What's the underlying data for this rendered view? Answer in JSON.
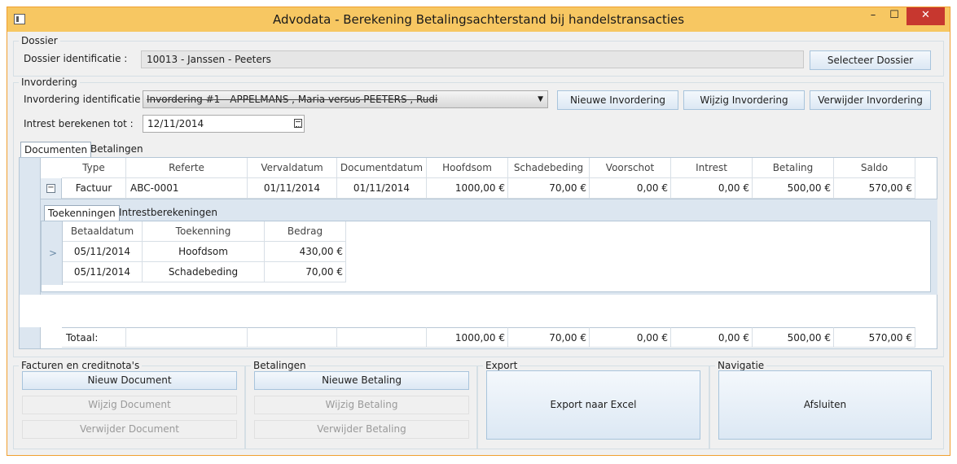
{
  "window": {
    "title": "Advodata - Berekening Betalingsachterstand bij handelstransacties",
    "minimize_icon": "minimize-icon",
    "maximize_icon": "maximize-icon",
    "close_icon": "close-icon",
    "minimize_glyph": "–",
    "maximize_glyph": "☐",
    "close_glyph": "✕"
  },
  "dossier": {
    "legend": "Dossier",
    "label": "Dossier identificatie :",
    "value": "10013 - Janssen - Peeters",
    "select_button": "Selecteer Dossier"
  },
  "invordering": {
    "legend": "Invordering",
    "label": "Invordering identificatie :",
    "selected": "Invordering #1 - APPELMANS , Maria  versus PEETERS , Rudi",
    "new_button": "Nieuwe Invordering",
    "edit_button": "Wijzig Invordering",
    "delete_button": "Verwijder Invordering",
    "interest_label": "Intrest berekenen tot :",
    "interest_date": "12/11/2014"
  },
  "tabs": {
    "documenten": "Documenten",
    "betalingen": "Betalingen"
  },
  "documents_table": {
    "columns": [
      "Type",
      "Referte",
      "Vervaldatum",
      "Documentdatum",
      "Hoofdsom",
      "Schadebeding",
      "Voorschot",
      "Intrest",
      "Betaling",
      "Saldo"
    ],
    "rows": [
      [
        "Factuur",
        "ABC-0001",
        "01/11/2014",
        "01/11/2014",
        "1000,00 €",
        "70,00 €",
        "0,00 €",
        "0,00 €",
        "500,00 €",
        "570,00 €"
      ]
    ],
    "expander_glyph": "−",
    "totals_label": "Totaal:",
    "totals": [
      "1000,00 €",
      "70,00 €",
      "0,00 €",
      "0,00 €",
      "500,00 €",
      "570,00 €"
    ]
  },
  "subtabs": {
    "toekenningen": "Toekenningen",
    "intrestberekeningen": "Intrestberekeningen"
  },
  "toekenningen_table": {
    "columns": [
      "Betaaldatum",
      "Toekenning",
      "Bedrag"
    ],
    "rows": [
      [
        "05/11/2014",
        "Hoofdsom",
        "430,00 €"
      ],
      [
        "05/11/2014",
        "Schadebeding",
        "70,00 €"
      ]
    ],
    "current_row_glyph": ">"
  },
  "facturen": {
    "legend": "Facturen en creditnota's",
    "new": "Nieuw Document",
    "edit": "Wijzig Document",
    "delete": "Verwijder Document"
  },
  "betalingen": {
    "legend": "Betalingen",
    "new": "Nieuwe Betaling",
    "edit": "Wijzig Betaling",
    "delete": "Verwijder Betaling"
  },
  "export": {
    "legend": "Export",
    "button": "Export naar Excel"
  },
  "navigatie": {
    "legend": "Navigatie",
    "button": "Afsluiten"
  },
  "colors": {
    "titlebar": "#f7c762",
    "close_button": "#c7372f",
    "button_border": "#a8c4dc"
  }
}
